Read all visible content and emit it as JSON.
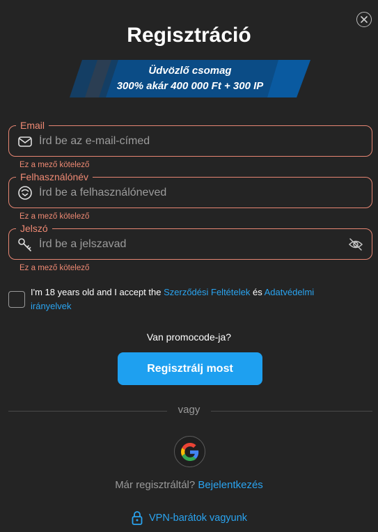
{
  "title": "Regisztráció",
  "banner": {
    "line1": "Üdvözlő csomag",
    "line2": "300% akár 400 000 Ft + 300 IP"
  },
  "fields": {
    "email": {
      "label": "Email",
      "placeholder": "Írd be az e-mail-címed",
      "value": "",
      "error": "Ez a mező kötelező"
    },
    "username": {
      "label": "Felhasználónév",
      "placeholder": "Írd be a felhasználóneved",
      "value": "",
      "error": "Ez a mező kötelező"
    },
    "password": {
      "label": "Jelszó",
      "placeholder": "Írd be a jelszavad",
      "value": "",
      "error": "Ez a mező kötelező"
    }
  },
  "terms": {
    "checked": false,
    "prefix": "I'm 18 years old and I accept the ",
    "link1": "Szerződési Feltételek",
    "middle": " és ",
    "link2": "Adatvédelmi irányelvek"
  },
  "promo_label": "Van promocode-ja?",
  "submit_label": "Regisztrálj most",
  "or_label": "vagy",
  "login": {
    "prompt": "Már regisztráltál?",
    "link": "Bejelentkezés"
  },
  "vpn_label": "VPN-barátok vagyunk",
  "colors": {
    "background": "#242424",
    "error": "#f08a74",
    "accent": "#1ea0f0",
    "banner_dark": "#0b4c86"
  },
  "icons": {
    "close": "close-icon",
    "email": "envelope-icon",
    "username": "user-icon",
    "password": "key-icon",
    "visibility": "eye-off-icon",
    "google": "google-icon",
    "vpn": "lock-icon"
  }
}
